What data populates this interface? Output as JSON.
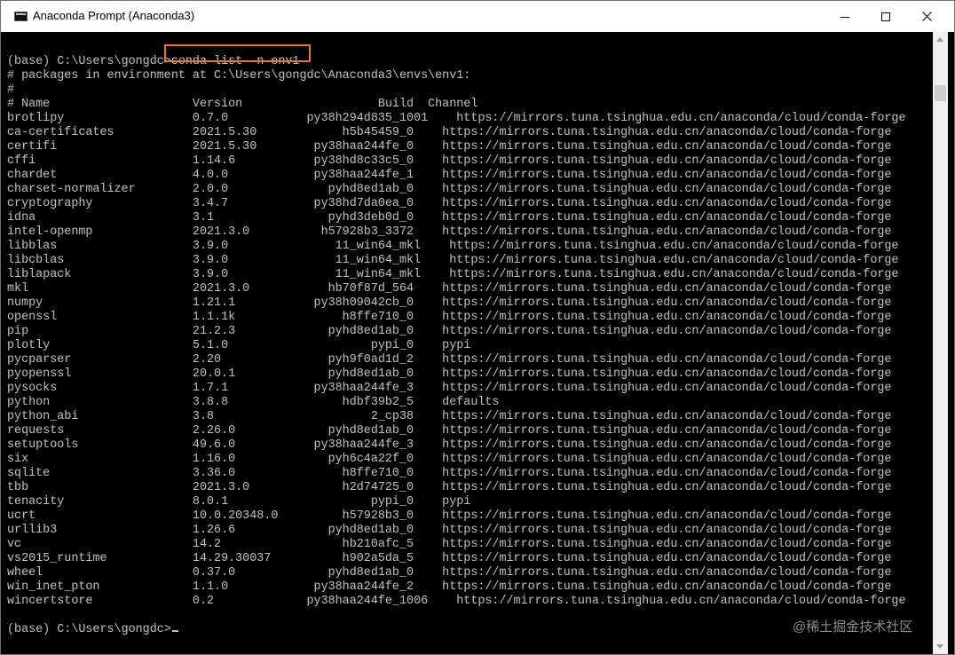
{
  "window": {
    "title": "Anaconda Prompt (Anaconda3)",
    "icon": "console-icon"
  },
  "console": {
    "lines": [
      "",
      "(base) C:\\Users\\gongdc>conda list -n env1",
      "# packages in environment at C:\\Users\\gongdc\\Anaconda3\\envs\\env1:",
      "#",
      "# Name                    Version                   Build  Channel",
      "brotlipy                  0.7.0           py38h294d835_1001    https://mirrors.tuna.tsinghua.edu.cn/anaconda/cloud/conda-forge",
      "ca-certificates           2021.5.30            h5b45459_0    https://mirrors.tuna.tsinghua.edu.cn/anaconda/cloud/conda-forge",
      "certifi                   2021.5.30        py38haa244fe_0    https://mirrors.tuna.tsinghua.edu.cn/anaconda/cloud/conda-forge",
      "cffi                      1.14.6           py38hd8c33c5_0    https://mirrors.tuna.tsinghua.edu.cn/anaconda/cloud/conda-forge",
      "chardet                   4.0.0            py38haa244fe_1    https://mirrors.tuna.tsinghua.edu.cn/anaconda/cloud/conda-forge",
      "charset-normalizer        2.0.0              pyhd8ed1ab_0    https://mirrors.tuna.tsinghua.edu.cn/anaconda/cloud/conda-forge",
      "cryptography              3.4.7            py38hd7da0ea_0    https://mirrors.tuna.tsinghua.edu.cn/anaconda/cloud/conda-forge",
      "idna                      3.1                pyhd3deb0d_0    https://mirrors.tuna.tsinghua.edu.cn/anaconda/cloud/conda-forge",
      "intel-openmp              2021.3.0          h57928b3_3372    https://mirrors.tuna.tsinghua.edu.cn/anaconda/cloud/conda-forge",
      "libblas                   3.9.0               11_win64_mkl    https://mirrors.tuna.tsinghua.edu.cn/anaconda/cloud/conda-forge",
      "libcblas                  3.9.0               11_win64_mkl    https://mirrors.tuna.tsinghua.edu.cn/anaconda/cloud/conda-forge",
      "liblapack                 3.9.0               11_win64_mkl    https://mirrors.tuna.tsinghua.edu.cn/anaconda/cloud/conda-forge",
      "mkl                       2021.3.0           hb70f87d_564    https://mirrors.tuna.tsinghua.edu.cn/anaconda/cloud/conda-forge",
      "numpy                     1.21.1           py38h09042cb_0    https://mirrors.tuna.tsinghua.edu.cn/anaconda/cloud/conda-forge",
      "openssl                   1.1.1k               h8ffe710_0    https://mirrors.tuna.tsinghua.edu.cn/anaconda/cloud/conda-forge",
      "pip                       21.2.3             pyhd8ed1ab_0    https://mirrors.tuna.tsinghua.edu.cn/anaconda/cloud/conda-forge",
      "plotly                    5.1.0                    pypi_0    pypi",
      "pycparser                 2.20               pyh9f0ad1d_2    https://mirrors.tuna.tsinghua.edu.cn/anaconda/cloud/conda-forge",
      "pyopenssl                 20.0.1             pyhd8ed1ab_0    https://mirrors.tuna.tsinghua.edu.cn/anaconda/cloud/conda-forge",
      "pysocks                   1.7.1            py38haa244fe_3    https://mirrors.tuna.tsinghua.edu.cn/anaconda/cloud/conda-forge",
      "python                    3.8.8                hdbf39b2_5    defaults",
      "python_abi                3.8                      2_cp38    https://mirrors.tuna.tsinghua.edu.cn/anaconda/cloud/conda-forge",
      "requests                  2.26.0             pyhd8ed1ab_0    https://mirrors.tuna.tsinghua.edu.cn/anaconda/cloud/conda-forge",
      "setuptools                49.6.0           py38haa244fe_3    https://mirrors.tuna.tsinghua.edu.cn/anaconda/cloud/conda-forge",
      "six                       1.16.0             pyh6c4a22f_0    https://mirrors.tuna.tsinghua.edu.cn/anaconda/cloud/conda-forge",
      "sqlite                    3.36.0               h8ffe710_0    https://mirrors.tuna.tsinghua.edu.cn/anaconda/cloud/conda-forge",
      "tbb                       2021.3.0             h2d74725_0    https://mirrors.tuna.tsinghua.edu.cn/anaconda/cloud/conda-forge",
      "tenacity                  8.0.1                    pypi_0    pypi",
      "ucrt                      10.0.20348.0         h57928b3_0    https://mirrors.tuna.tsinghua.edu.cn/anaconda/cloud/conda-forge",
      "urllib3                   1.26.6             pyhd8ed1ab_0    https://mirrors.tuna.tsinghua.edu.cn/anaconda/cloud/conda-forge",
      "vc                        14.2                 hb210afc_5    https://mirrors.tuna.tsinghua.edu.cn/anaconda/cloud/conda-forge",
      "vs2015_runtime            14.29.30037          h902a5da_5    https://mirrors.tuna.tsinghua.edu.cn/anaconda/cloud/conda-forge",
      "wheel                     0.37.0             pyhd8ed1ab_0    https://mirrors.tuna.tsinghua.edu.cn/anaconda/cloud/conda-forge",
      "win_inet_pton             1.1.0            py38haa244fe_2    https://mirrors.tuna.tsinghua.edu.cn/anaconda/cloud/conda-forge",
      "wincertstore              0.2             py38haa244fe_1006    https://mirrors.tuna.tsinghua.edu.cn/anaconda/cloud/conda-forge",
      "",
      "(base) C:\\Users\\gongdc>"
    ]
  },
  "highlight": {
    "color": "#e8743b"
  },
  "watermark": {
    "text": "@稀土掘金技术社区"
  }
}
